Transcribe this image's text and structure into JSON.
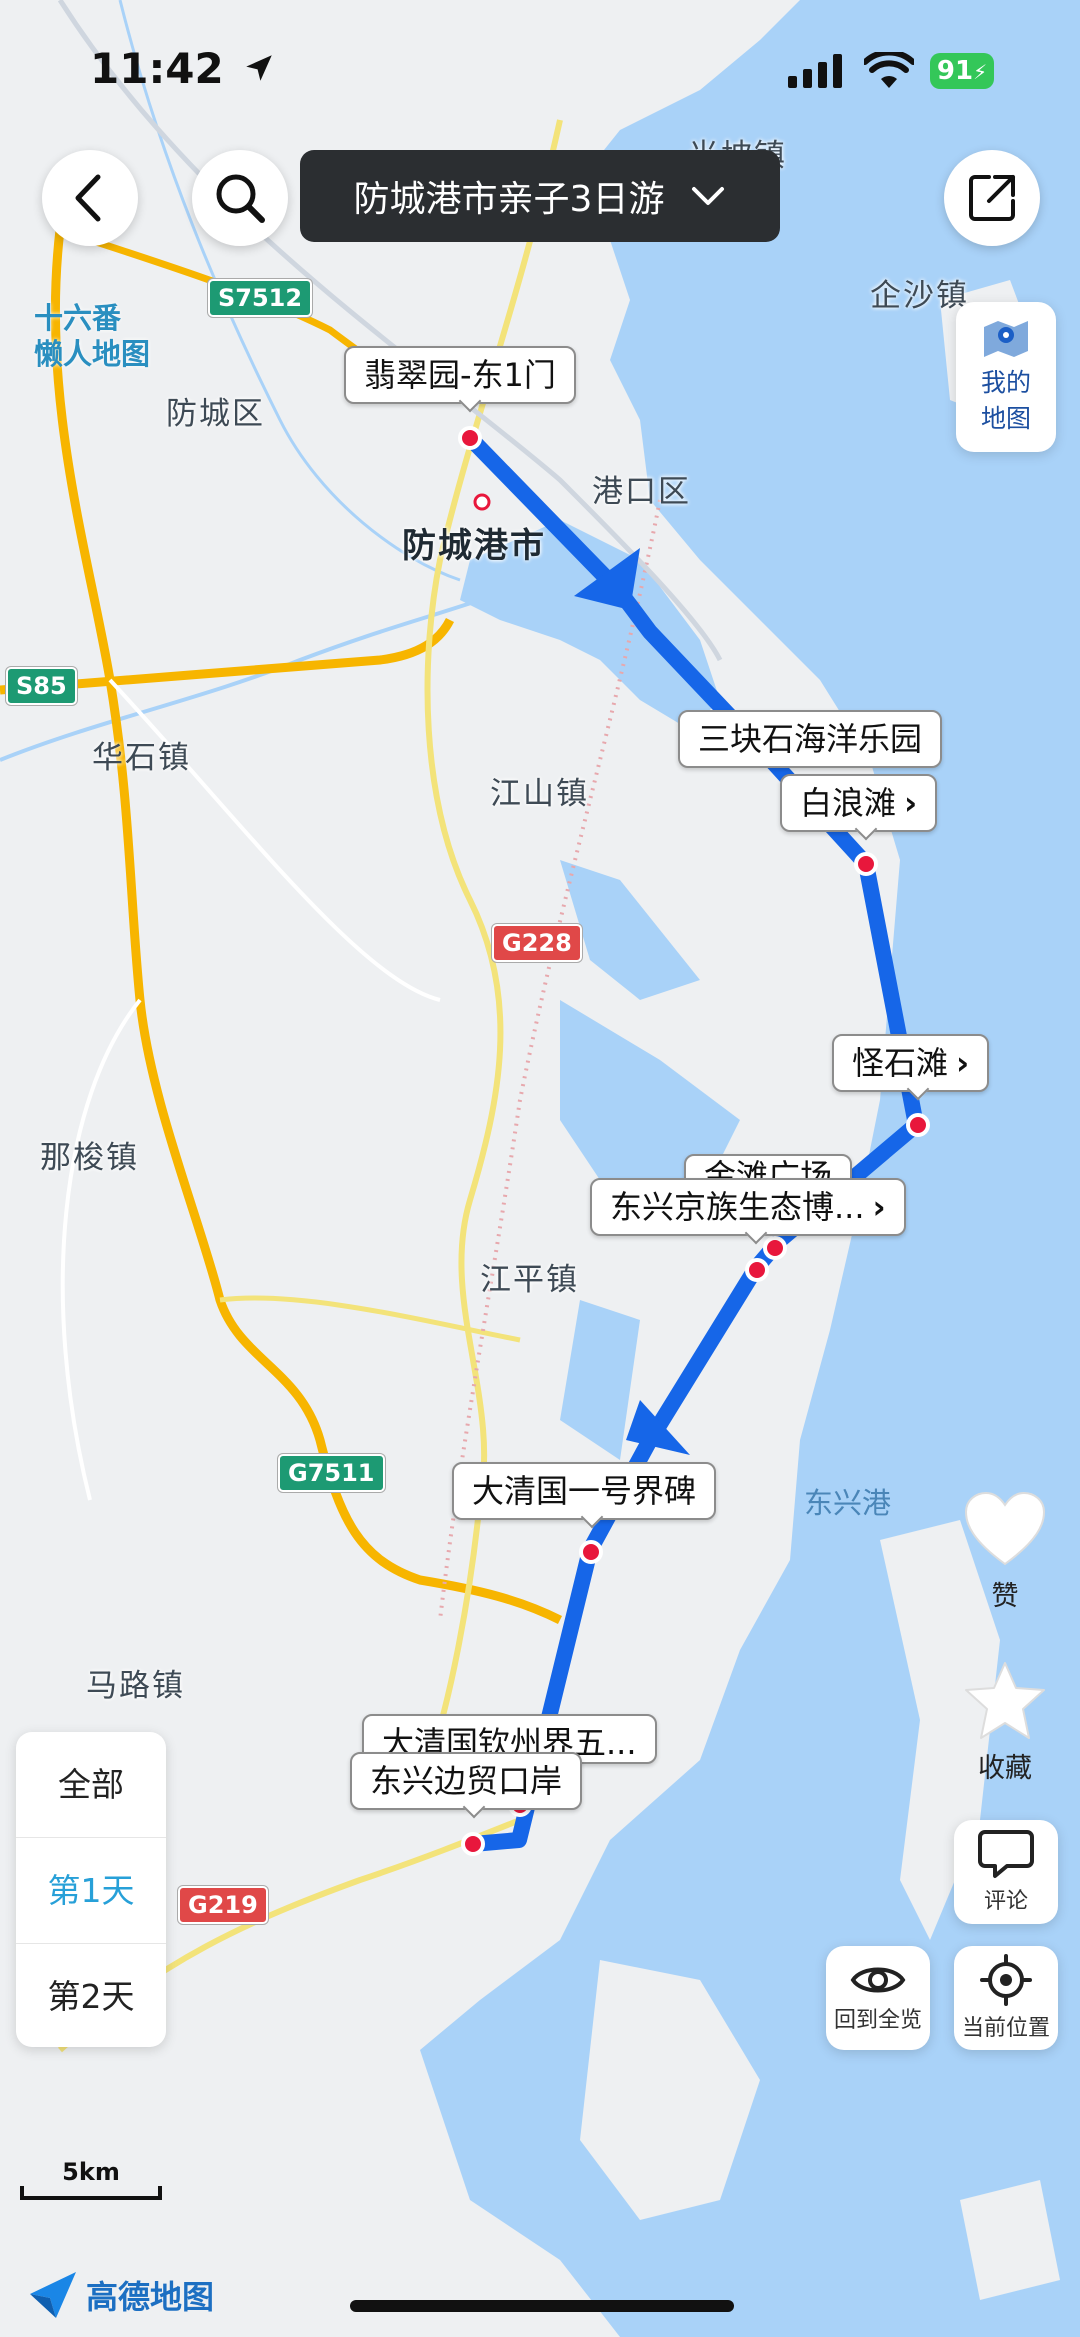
{
  "status_bar": {
    "time": "11:42",
    "battery": "91"
  },
  "header": {
    "trip_title": "防城港市亲子3日游"
  },
  "side_button": {
    "line1": "我的",
    "line2": "地图"
  },
  "map_labels": {
    "guangpo": "光坡镇",
    "qisha": "企沙镇",
    "fangcheng_qu": "防城区",
    "gangkou_qu": "港口区",
    "fangchenggang_shi": "防城港市",
    "huashi": "华石镇",
    "jiangshan": "江山镇",
    "nasuo": "那梭镇",
    "jiangping": "江平镇",
    "malu": "马路镇",
    "dongxing_gang": "东兴港",
    "lazy_map": "十六番\n懒人地图"
  },
  "road_shields": {
    "s7512": "S7512",
    "s85": "S85",
    "g228": "G228",
    "g7511": "G7511",
    "g219": "G219"
  },
  "pois": [
    {
      "label": "翡翠园-东1门",
      "arrow": false
    },
    {
      "label": "三块石海洋乐园",
      "arrow": false
    },
    {
      "label": "白浪滩",
      "arrow": true
    },
    {
      "label": "怪石滩",
      "arrow": true
    },
    {
      "label": "金滩广场",
      "arrow": false
    },
    {
      "label": "东兴京族生态博...",
      "arrow": true
    },
    {
      "label": "大清国一号界碑",
      "arrow": false
    },
    {
      "label": "大清国钦州界五...",
      "arrow": false
    },
    {
      "label": "东兴边贸口岸",
      "arrow": false
    }
  ],
  "day_filter": {
    "items": [
      "全部",
      "第1天",
      "第2天"
    ],
    "active_index": 1
  },
  "actions": {
    "like": "赞",
    "collect": "收藏",
    "comment": "评论",
    "overview": "回到全览",
    "locate": "当前位置"
  },
  "scale": "5km",
  "brand": "高德地图",
  "colors": {
    "route": "#1666e8",
    "active_day": "#27a0d8",
    "water": "#a9d2f8",
    "land": "#eef0f2"
  }
}
